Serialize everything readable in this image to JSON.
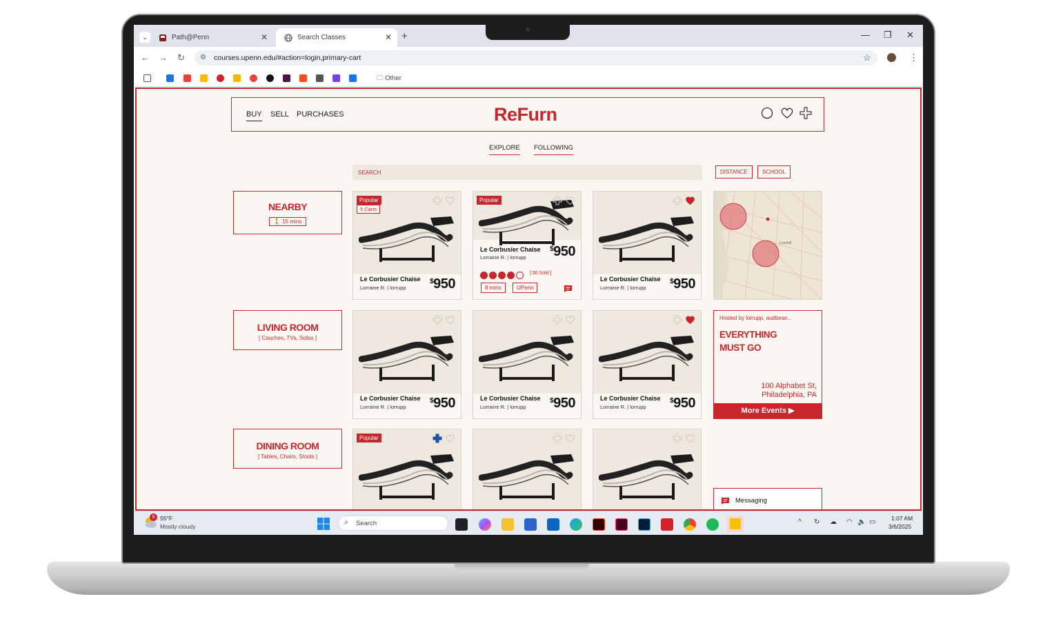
{
  "browser": {
    "tabs": [
      {
        "label": "Path@Penn",
        "active": false
      },
      {
        "label": "Search Classes",
        "active": true
      }
    ],
    "url": "courses.upenn.edu/#action=login,primary-cart",
    "bookmarks_other": "Other"
  },
  "app": {
    "logo": "ReFurn",
    "nav": {
      "buy": "BUY",
      "sell": "SELL",
      "purchases": "PURCHASES"
    },
    "subtabs": {
      "explore": "EXPLORE",
      "following": "FOLLOWING"
    },
    "search_label": "SEARCH",
    "filters": {
      "distance": "DISTANCE",
      "school": "SCHOOL"
    },
    "categories": [
      {
        "title": "NEARBY",
        "sub": "Ὣ6 15 mins"
      },
      {
        "title": "LIVING ROOM",
        "sub": "[ Couches, TVs, Sofas ]"
      },
      {
        "title": "DINING ROOM",
        "sub": "[ Tables, Chairs, Stools ]"
      }
    ],
    "nearby_walk": "15 mins",
    "product": {
      "name": "Le Corbusier Chaise",
      "seller": "Lorraine R. | lorrupp",
      "currency": "$",
      "price": "950"
    },
    "badges": {
      "popular": "Popular",
      "carts": "5 Carts"
    },
    "expanded": {
      "sold": "[ 50 Sold ]",
      "rating": 4,
      "time": "8 mins",
      "school": "UPenn"
    },
    "event": {
      "hosted": "Hosted by lorrupp, audbean...",
      "title_line1": "EVERYTHING",
      "title_line2": "MUST GO",
      "address_line1": "100 Alphabet St,",
      "address_line2": "Philadelphia, PA",
      "more": "More Events ▶"
    },
    "map": {
      "label": "Lovehill"
    },
    "messaging": "Messaging",
    "colors": {
      "brand": "#c8262c",
      "background": "#faf6f1",
      "plus_active": "#1f4fa8"
    }
  },
  "taskbar": {
    "weather_temp": "55°F",
    "weather_desc": "Mostly cloudy",
    "weather_badge": "6",
    "search_placeholder": "Search",
    "time": "1:07 AM",
    "date": "3/6/2025"
  }
}
